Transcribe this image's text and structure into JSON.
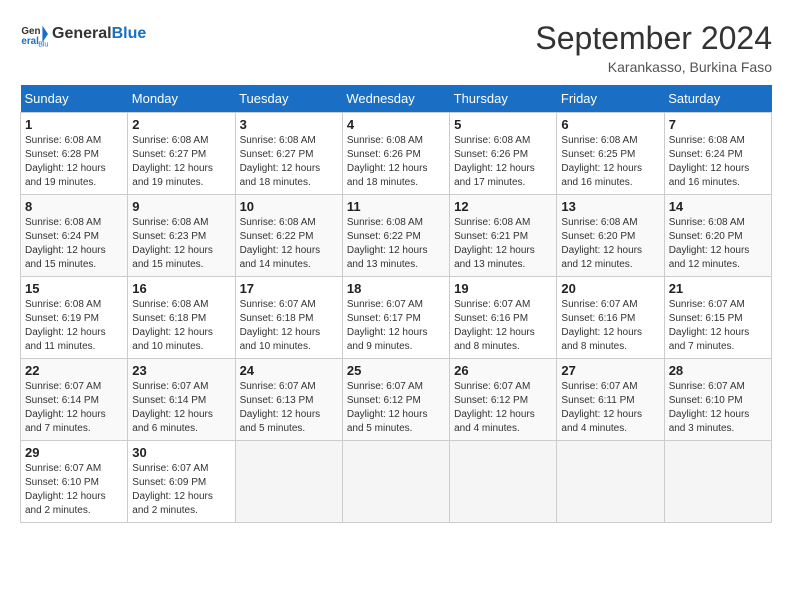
{
  "header": {
    "logo_line1": "General",
    "logo_line2": "Blue",
    "month_year": "September 2024",
    "location": "Karankasso, Burkina Faso"
  },
  "weekdays": [
    "Sunday",
    "Monday",
    "Tuesday",
    "Wednesday",
    "Thursday",
    "Friday",
    "Saturday"
  ],
  "weeks": [
    [
      {
        "day": "1",
        "sunrise": "6:08 AM",
        "sunset": "6:28 PM",
        "daylight": "12 hours and 19 minutes."
      },
      {
        "day": "2",
        "sunrise": "6:08 AM",
        "sunset": "6:27 PM",
        "daylight": "12 hours and 19 minutes."
      },
      {
        "day": "3",
        "sunrise": "6:08 AM",
        "sunset": "6:27 PM",
        "daylight": "12 hours and 18 minutes."
      },
      {
        "day": "4",
        "sunrise": "6:08 AM",
        "sunset": "6:26 PM",
        "daylight": "12 hours and 18 minutes."
      },
      {
        "day": "5",
        "sunrise": "6:08 AM",
        "sunset": "6:26 PM",
        "daylight": "12 hours and 17 minutes."
      },
      {
        "day": "6",
        "sunrise": "6:08 AM",
        "sunset": "6:25 PM",
        "daylight": "12 hours and 16 minutes."
      },
      {
        "day": "7",
        "sunrise": "6:08 AM",
        "sunset": "6:24 PM",
        "daylight": "12 hours and 16 minutes."
      }
    ],
    [
      {
        "day": "8",
        "sunrise": "6:08 AM",
        "sunset": "6:24 PM",
        "daylight": "12 hours and 15 minutes."
      },
      {
        "day": "9",
        "sunrise": "6:08 AM",
        "sunset": "6:23 PM",
        "daylight": "12 hours and 15 minutes."
      },
      {
        "day": "10",
        "sunrise": "6:08 AM",
        "sunset": "6:22 PM",
        "daylight": "12 hours and 14 minutes."
      },
      {
        "day": "11",
        "sunrise": "6:08 AM",
        "sunset": "6:22 PM",
        "daylight": "12 hours and 13 minutes."
      },
      {
        "day": "12",
        "sunrise": "6:08 AM",
        "sunset": "6:21 PM",
        "daylight": "12 hours and 13 minutes."
      },
      {
        "day": "13",
        "sunrise": "6:08 AM",
        "sunset": "6:20 PM",
        "daylight": "12 hours and 12 minutes."
      },
      {
        "day": "14",
        "sunrise": "6:08 AM",
        "sunset": "6:20 PM",
        "daylight": "12 hours and 12 minutes."
      }
    ],
    [
      {
        "day": "15",
        "sunrise": "6:08 AM",
        "sunset": "6:19 PM",
        "daylight": "12 hours and 11 minutes."
      },
      {
        "day": "16",
        "sunrise": "6:08 AM",
        "sunset": "6:18 PM",
        "daylight": "12 hours and 10 minutes."
      },
      {
        "day": "17",
        "sunrise": "6:07 AM",
        "sunset": "6:18 PM",
        "daylight": "12 hours and 10 minutes."
      },
      {
        "day": "18",
        "sunrise": "6:07 AM",
        "sunset": "6:17 PM",
        "daylight": "12 hours and 9 minutes."
      },
      {
        "day": "19",
        "sunrise": "6:07 AM",
        "sunset": "6:16 PM",
        "daylight": "12 hours and 8 minutes."
      },
      {
        "day": "20",
        "sunrise": "6:07 AM",
        "sunset": "6:16 PM",
        "daylight": "12 hours and 8 minutes."
      },
      {
        "day": "21",
        "sunrise": "6:07 AM",
        "sunset": "6:15 PM",
        "daylight": "12 hours and 7 minutes."
      }
    ],
    [
      {
        "day": "22",
        "sunrise": "6:07 AM",
        "sunset": "6:14 PM",
        "daylight": "12 hours and 7 minutes."
      },
      {
        "day": "23",
        "sunrise": "6:07 AM",
        "sunset": "6:14 PM",
        "daylight": "12 hours and 6 minutes."
      },
      {
        "day": "24",
        "sunrise": "6:07 AM",
        "sunset": "6:13 PM",
        "daylight": "12 hours and 5 minutes."
      },
      {
        "day": "25",
        "sunrise": "6:07 AM",
        "sunset": "6:12 PM",
        "daylight": "12 hours and 5 minutes."
      },
      {
        "day": "26",
        "sunrise": "6:07 AM",
        "sunset": "6:12 PM",
        "daylight": "12 hours and 4 minutes."
      },
      {
        "day": "27",
        "sunrise": "6:07 AM",
        "sunset": "6:11 PM",
        "daylight": "12 hours and 4 minutes."
      },
      {
        "day": "28",
        "sunrise": "6:07 AM",
        "sunset": "6:10 PM",
        "daylight": "12 hours and 3 minutes."
      }
    ],
    [
      {
        "day": "29",
        "sunrise": "6:07 AM",
        "sunset": "6:10 PM",
        "daylight": "12 hours and 2 minutes."
      },
      {
        "day": "30",
        "sunrise": "6:07 AM",
        "sunset": "6:09 PM",
        "daylight": "12 hours and 2 minutes."
      },
      null,
      null,
      null,
      null,
      null
    ]
  ]
}
